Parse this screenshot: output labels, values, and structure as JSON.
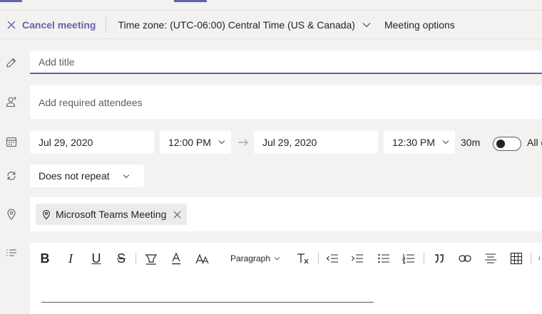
{
  "toolbar": {
    "cancel_label": "Cancel meeting",
    "timezone_label": "Time zone: (UTC-06:00) Central Time (US & Canada)",
    "meeting_options_label": "Meeting options"
  },
  "form": {
    "title_placeholder": "Add title",
    "attendees_placeholder": "Add required attendees",
    "start_date": "Jul 29, 2020",
    "start_time": "12:00 PM",
    "end_date": "Jul 29, 2020",
    "end_time": "12:30 PM",
    "duration": "30m",
    "all_day_label": "All day",
    "all_day_on": false,
    "repeat": "Does not repeat",
    "location_chip": "Microsoft Teams Meeting"
  },
  "editor": {
    "paragraph_label": "Paragraph"
  },
  "colors": {
    "accent": "#6264a7",
    "background": "#f3f2f1",
    "field": "#ffffff"
  }
}
